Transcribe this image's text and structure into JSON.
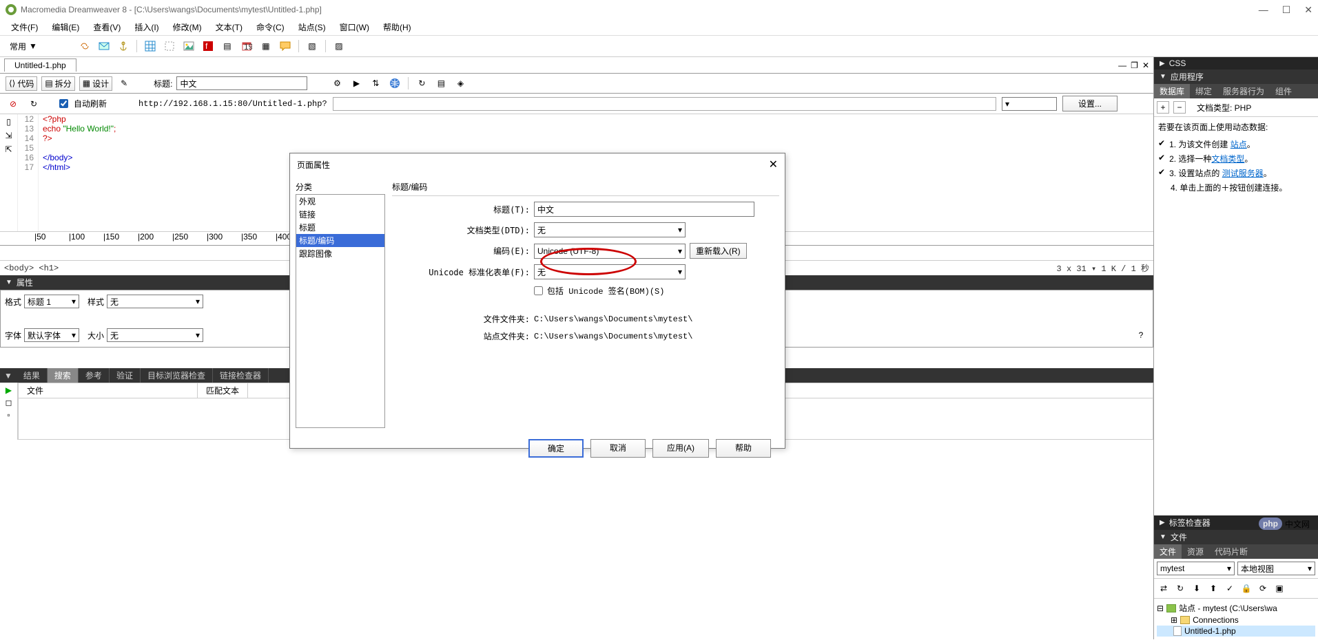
{
  "titlebar": {
    "title": "Macromedia Dreamweaver 8 - [C:\\Users\\wangs\\Documents\\mytest\\Untitled-1.php]",
    "min": "—",
    "max": "☐",
    "close": "✕"
  },
  "menu": {
    "file": "文件(F)",
    "edit": "编辑(E)",
    "view": "查看(V)",
    "insert": "插入(I)",
    "modify": "修改(M)",
    "text": "文本(T)",
    "commands": "命令(C)",
    "site": "站点(S)",
    "window": "窗口(W)",
    "help": "帮助(H)"
  },
  "toolbar": {
    "common_label": "常用",
    "dropdown_arrow": "▼"
  },
  "document": {
    "tab": "Untitled-1.php",
    "view_code": "代码",
    "view_split": "拆分",
    "view_design": "设计",
    "title_label": "标题:",
    "title_value": "中文"
  },
  "addressbar": {
    "auto_refresh": "自动刷新",
    "url": "http://192.168.1.15:80/Untitled-1.php?",
    "settings_btn": "设置..."
  },
  "code": {
    "lines": [
      "12",
      "13",
      "14",
      "15",
      "16",
      "17"
    ],
    "l12": "<?php",
    "l13a": "echo",
    "l13b": "\"Hello World!\"",
    "l13c": ";",
    "l14": "?>",
    "l16": "</body>",
    "l17": "</html>"
  },
  "statusbar": {
    "path": "<body> <h1>",
    "right": "3 x 31 ▾ 1 K / 1 秒"
  },
  "properties": {
    "panel_title": "属性",
    "format_label": "格式",
    "format_value": "标题 1",
    "style_label": "样式",
    "style_value": "无",
    "font_label": "字体",
    "font_value": "默认字体",
    "size_label": "大小",
    "size_value": "无"
  },
  "results": {
    "panel_title": "结果",
    "tabs": [
      "搜索",
      "参考",
      "验证",
      "目标浏览器检查",
      "链接检查器"
    ],
    "col_file": "文件",
    "col_match": "匹配文本"
  },
  "right": {
    "css_panel": "CSS",
    "app_panel": "应用程序",
    "db_tabs": [
      "数据库",
      "绑定",
      "服务器行为",
      "组件"
    ],
    "doctype_label": "文档类型: PHP",
    "dynamic_intro": "若要在该页面上使用动态数据:",
    "step1_prefix": "1. 为该文件创建",
    "step1_link": "站点",
    "step1_suffix": "。",
    "step2_prefix": "2. 选择一种",
    "step2_link": "文档类型",
    "step2_suffix": "。",
    "step3_prefix": "3. 设置站点的",
    "step3_link": "测试服务器",
    "step3_suffix": "。",
    "step4": "4. 单击上面的＋按钮创建连接。",
    "tag_panel": "标签检查器",
    "files_panel": "文件",
    "files_tabs": [
      "文件",
      "资源",
      "代码片断"
    ],
    "site_dropdown": "mytest",
    "view_dropdown": "本地视图",
    "tree_root": "站点 - mytest (C:\\Users\\wa",
    "tree_conn": "Connections",
    "tree_file": "Untitled-1.php"
  },
  "dialog": {
    "title": "页面属性",
    "category_label": "分类",
    "categories": [
      "外观",
      "链接",
      "标题",
      "标题/编码",
      "跟踪图像"
    ],
    "section_title": "标题/编码",
    "title_label": "标题(T):",
    "title_value": "中文",
    "dtd_label": "文档类型(DTD):",
    "dtd_value": "无",
    "encoding_label": "编码(E):",
    "encoding_value": "Unicode (UTF-8)",
    "reload_btn": "重新载入(R)",
    "normalize_label": "Unicode 标准化表单(F):",
    "normalize_value": "无",
    "bom_label": "包括 Unicode 签名(BOM)(S)",
    "file_folder_label": "文件文件夹:",
    "file_folder_value": "C:\\Users\\wangs\\Documents\\mytest\\",
    "site_folder_label": "站点文件夹:",
    "site_folder_value": "C:\\Users\\wangs\\Documents\\mytest\\",
    "ok_btn": "确定",
    "cancel_btn": "取消",
    "apply_btn": "应用(A)",
    "help_btn": "帮助"
  },
  "watermark": {
    "php": "php",
    "text": "中文网"
  }
}
